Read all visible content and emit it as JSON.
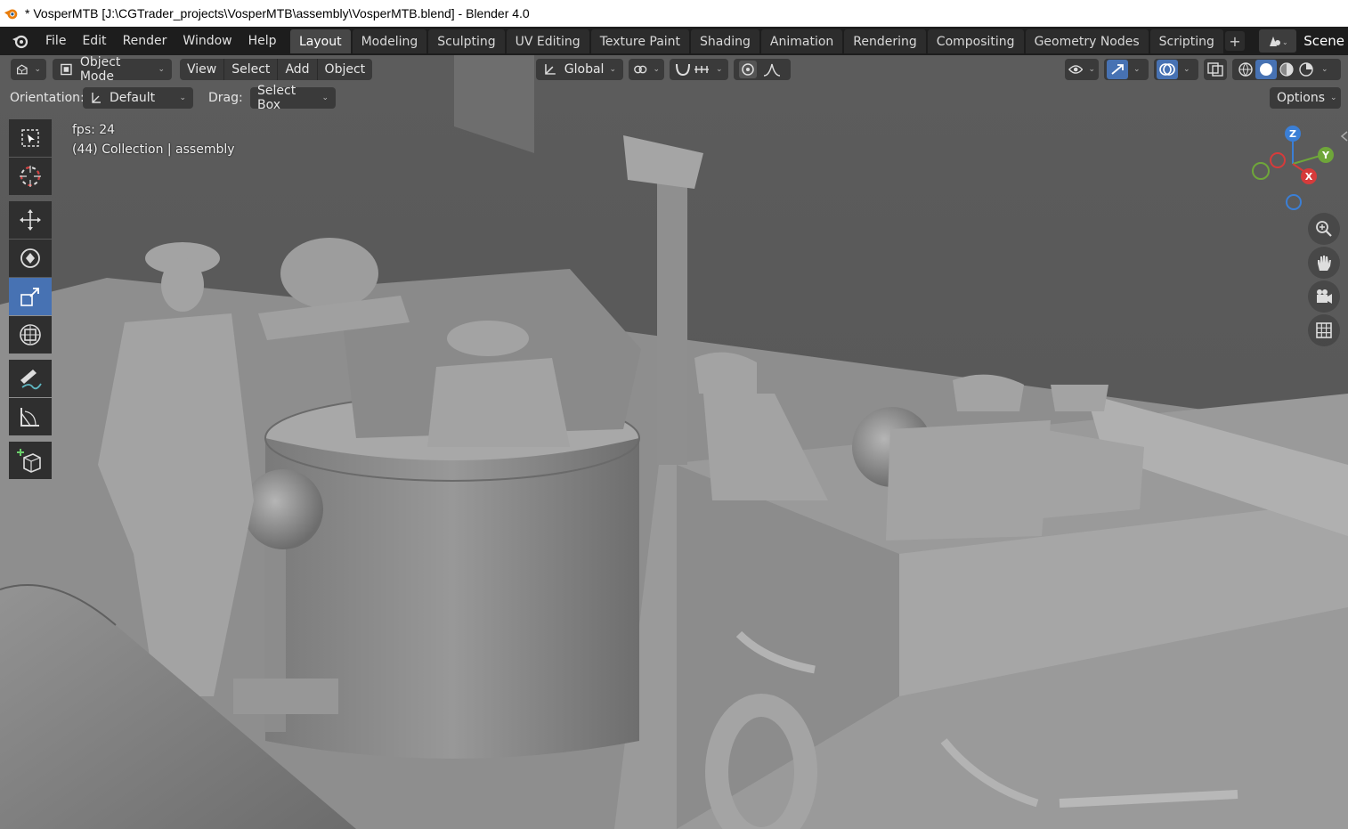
{
  "window": {
    "title": "* VosperMTB [J:\\CGTrader_projects\\VosperMTB\\assembly\\VosperMTB.blend] - Blender 4.0"
  },
  "menu": {
    "items": [
      "File",
      "Edit",
      "Render",
      "Window",
      "Help"
    ]
  },
  "workspaces": [
    "Layout",
    "Modeling",
    "Sculpting",
    "UV Editing",
    "Texture Paint",
    "Shading",
    "Animation",
    "Rendering",
    "Compositing",
    "Geometry Nodes",
    "Scripting"
  ],
  "active_workspace": "Layout",
  "scene": {
    "label": "Scene"
  },
  "viewport_header": {
    "mode": "Object Mode",
    "menus": [
      "View",
      "Select",
      "Add",
      "Object"
    ],
    "transform_orientation": "Global"
  },
  "tool_settings": {
    "orientation_label": "Orientation:",
    "orientation_value": "Default",
    "drag_label": "Drag:",
    "drag_value": "Select Box",
    "options_label": "Options"
  },
  "overlay": {
    "fps": "fps: 24",
    "collection": "(44) Collection | assembly"
  },
  "gizmo": {
    "z": "Z",
    "y": "Y",
    "x": "X"
  },
  "colors": {
    "accent": "#4772b3",
    "x_axis": "#d63b3b",
    "y_axis": "#6fa63a",
    "z_axis": "#3b7fd6"
  }
}
